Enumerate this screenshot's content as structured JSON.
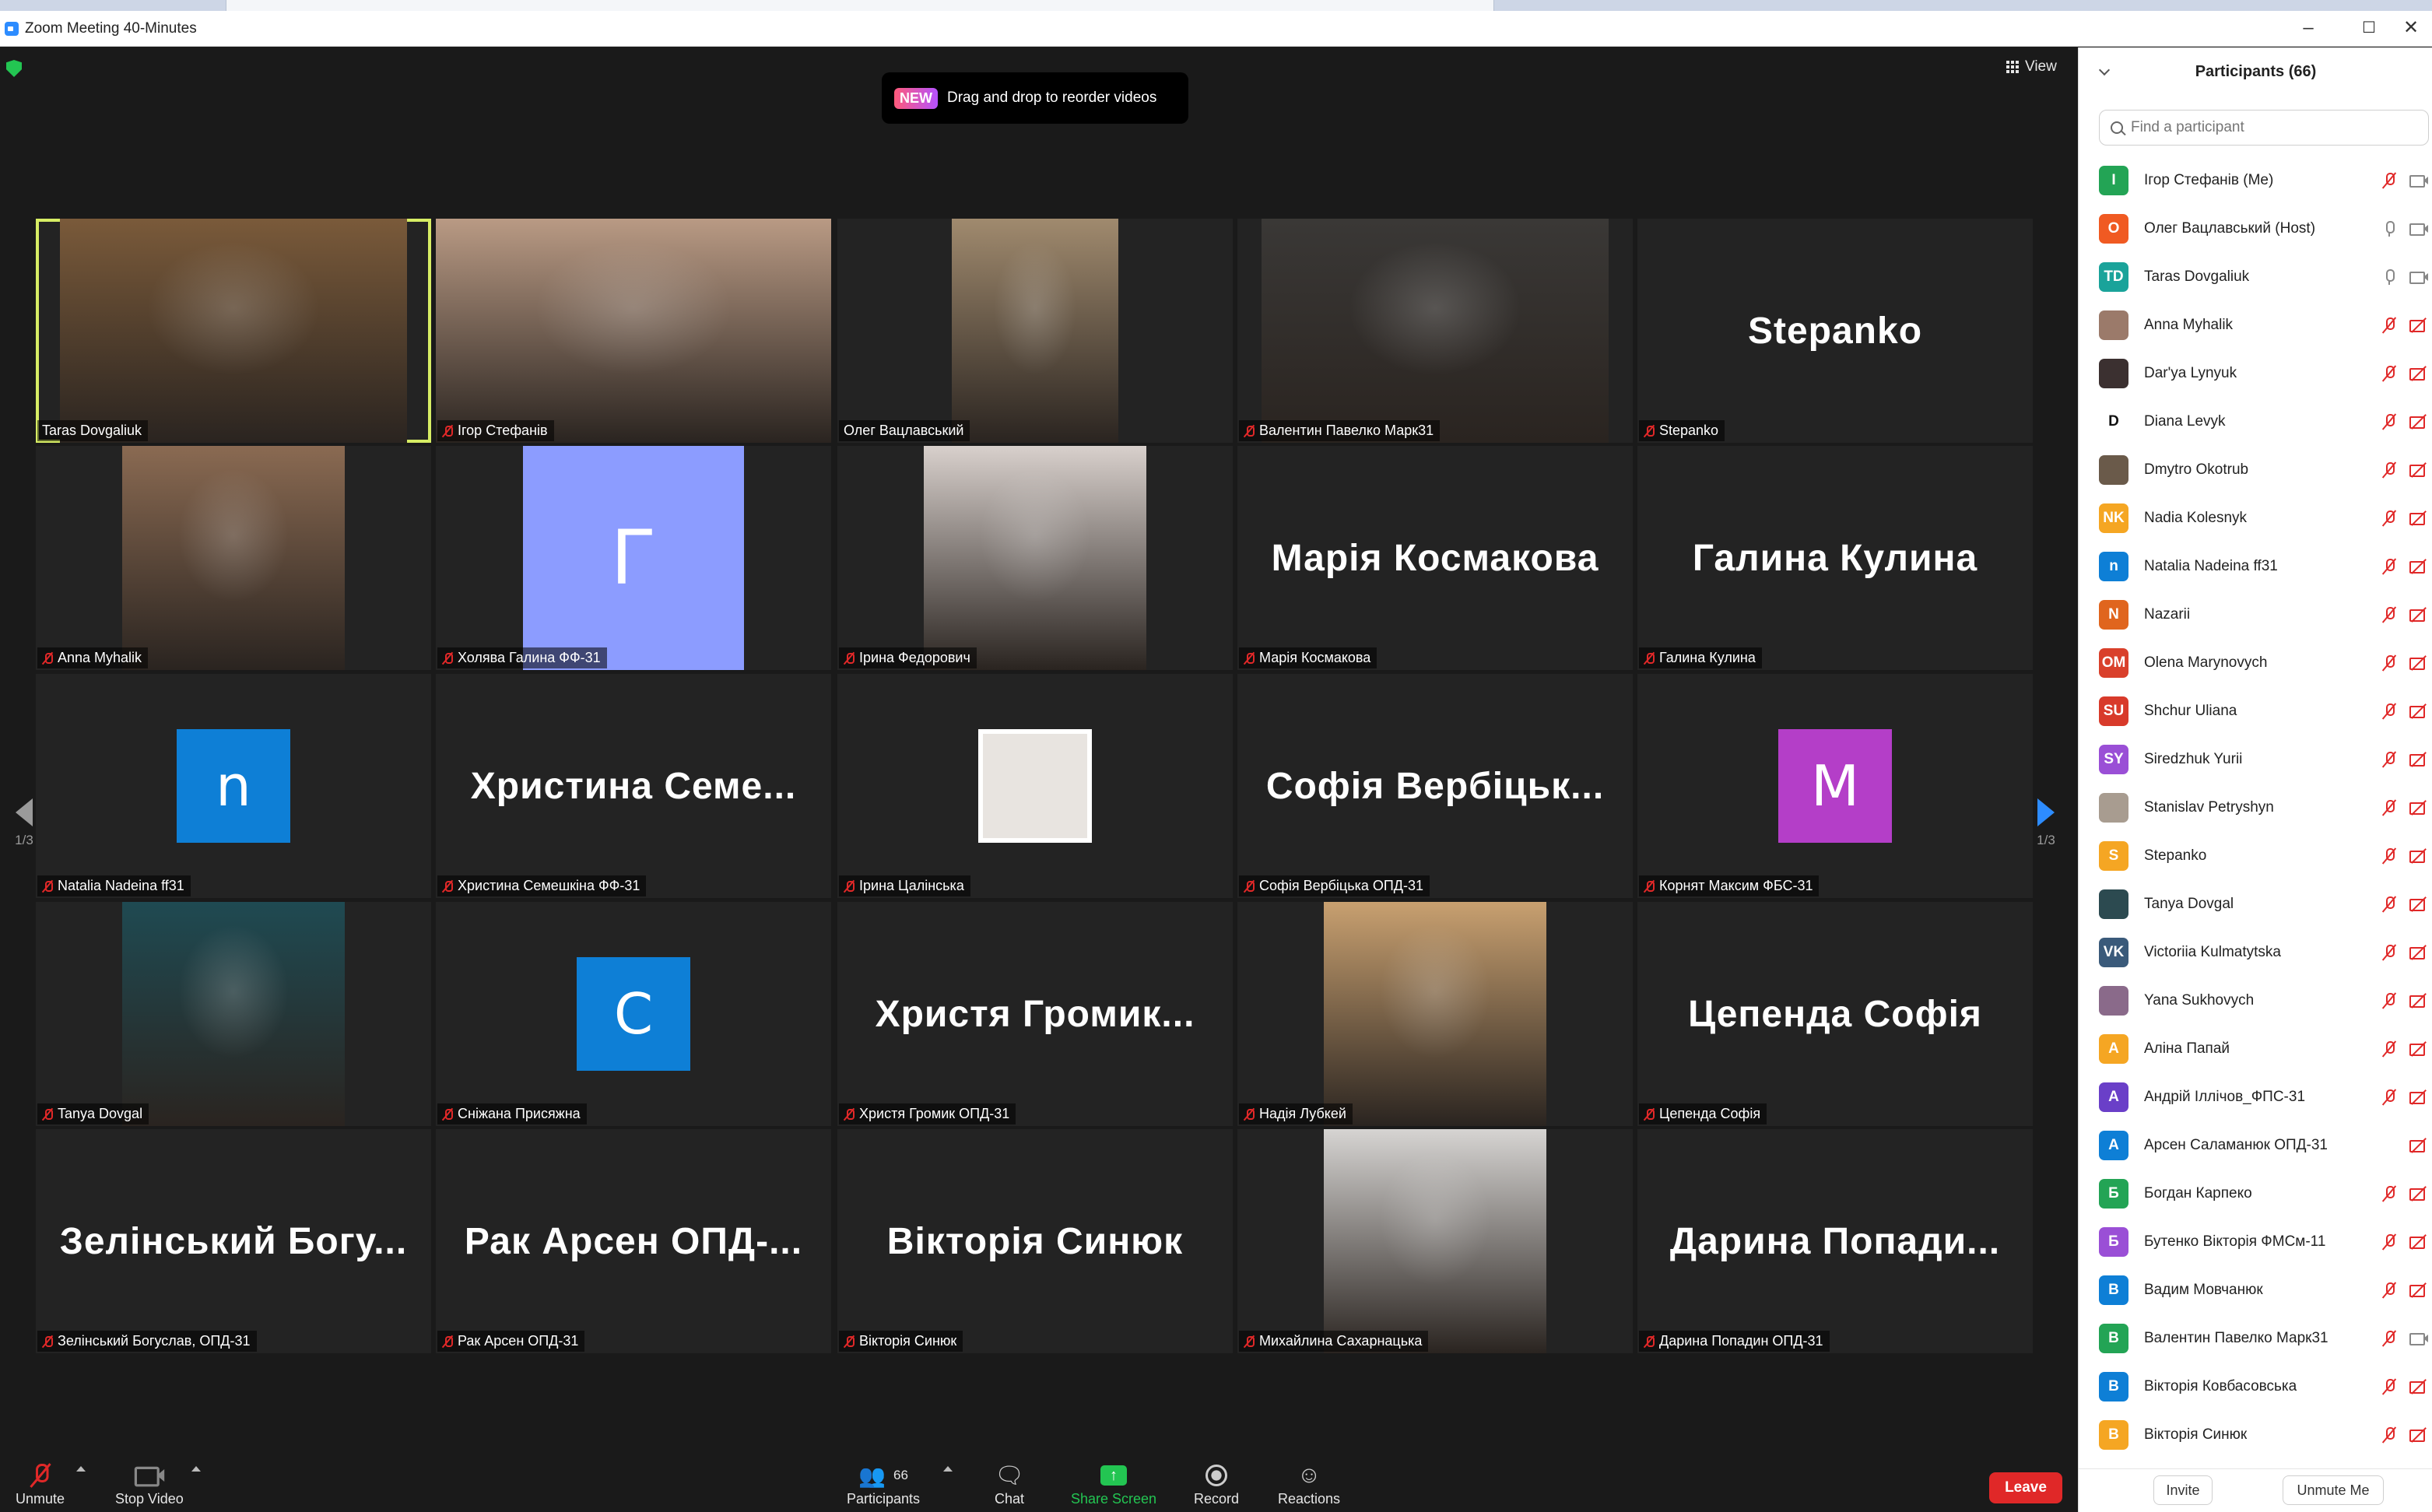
{
  "window": {
    "title": "Zoom Meeting 40-Minutes"
  },
  "toast": {
    "badge": "NEW",
    "message": "Drag and drop to reorder videos"
  },
  "view_label": "View",
  "pagination": {
    "left": "1/3",
    "right": "1/3"
  },
  "tiles": [
    {
      "label": "Taras Dovgaliuk",
      "muted": false,
      "active": true,
      "kind": "photo",
      "photo_color": "#7a5a3a"
    },
    {
      "label": "Ігор Стефанів",
      "muted": true,
      "kind": "photo",
      "photo_color": "#b99a84"
    },
    {
      "label": "Олег Вацлавський",
      "muted": false,
      "kind": "photo",
      "photo_color": "#a08a6e"
    },
    {
      "label": "Валентин Павелко Марк31",
      "muted": true,
      "kind": "photo",
      "photo_color": "#3a3836"
    },
    {
      "label": "Stepanko",
      "muted": true,
      "kind": "name",
      "big": "Stepanko"
    },
    {
      "label": "Anna Myhalik",
      "muted": true,
      "kind": "photo",
      "photo_color": "#8a6a52"
    },
    {
      "label": "Холява Галина ФФ-31",
      "muted": true,
      "kind": "letter",
      "letter": "Г",
      "letter_color": "#8c9cff"
    },
    {
      "label": "Ірина Федорович",
      "muted": true,
      "kind": "photo",
      "photo_color": "#d8d0cc"
    },
    {
      "label": "Марія Космакова",
      "muted": true,
      "kind": "name",
      "big": "Марія Космакова"
    },
    {
      "label": "Галина Кулина",
      "muted": true,
      "kind": "name",
      "big": "Галина Кулина"
    },
    {
      "label": "Natalia Nadeina ff31",
      "muted": true,
      "kind": "letter",
      "letter": "n",
      "letter_color": "#0e7fd6"
    },
    {
      "label": "Христина Семешкіна ФФ-31",
      "muted": true,
      "kind": "name",
      "big": "Христина Семе..."
    },
    {
      "label": "Ірина Цалінська",
      "muted": true,
      "kind": "smallphoto",
      "photo_color": "#e8e4e0"
    },
    {
      "label": "Софія Вербіцька ОПД-31",
      "muted": true,
      "kind": "name",
      "big": "Софія Вербіцьк..."
    },
    {
      "label": "Корнят Максим ФБС-31",
      "muted": true,
      "kind": "letter",
      "letter": "M",
      "letter_color": "#b43ec8"
    },
    {
      "label": "Tanya Dovgal",
      "muted": true,
      "kind": "photo",
      "photo_color": "#1f4a52"
    },
    {
      "label": "Сніжана Присяжна",
      "muted": true,
      "kind": "letter",
      "letter": "C",
      "letter_color": "#0e7fd6"
    },
    {
      "label": "Христя Громик ОПД-31",
      "muted": true,
      "kind": "name",
      "big": "Христя Громик..."
    },
    {
      "label": "Надія Лубкей",
      "muted": true,
      "kind": "photo",
      "photo_color": "#c8a070"
    },
    {
      "label": "Цепенда Софія",
      "muted": true,
      "kind": "name",
      "big": "Цепенда Софія"
    },
    {
      "label": "Зелінський Богуслав, ОПД-31",
      "muted": true,
      "kind": "name",
      "big": "Зелінський Богу..."
    },
    {
      "label": "Рак Арсен ОПД-31",
      "muted": true,
      "kind": "name",
      "big": "Рак Арсен ОПД-..."
    },
    {
      "label": "Вікторія Синюк",
      "muted": true,
      "kind": "name",
      "big": "Вікторія Синюк"
    },
    {
      "label": "Михайлина Сахарнацька",
      "muted": true,
      "kind": "photo",
      "photo_color": "#d6d4d2"
    },
    {
      "label": "Дарина Попадин ОПД-31",
      "muted": true,
      "kind": "name",
      "big": "Дарина Попади..."
    }
  ],
  "toolbar": {
    "unmute": "Unmute",
    "stop_video": "Stop Video",
    "participants": "Participants",
    "participants_count": "66",
    "chat": "Chat",
    "share_screen": "Share Screen",
    "record": "Record",
    "reactions": "Reactions",
    "leave": "Leave"
  },
  "panel": {
    "title": "Participants (66)",
    "search_placeholder": "Find a participant",
    "invite": "Invite",
    "unmute_me": "Unmute Me",
    "participants": [
      {
        "initials": "I",
        "color": "#23a455",
        "name": "Ігор Стефанів (Me)",
        "mic": "muted",
        "cam": "on"
      },
      {
        "initials": "O",
        "color": "#f05a22",
        "name": "Олег Вацлавський (Host)",
        "mic": "on",
        "cam": "on"
      },
      {
        "initials": "TD",
        "color": "#1aa39a",
        "name": "Taras Dovgaliuk",
        "mic": "on",
        "cam": "on"
      },
      {
        "initials": "",
        "color": "#9b7a6a",
        "name": "Anna Myhalik",
        "mic": "muted",
        "cam": "off"
      },
      {
        "initials": "",
        "color": "#3b3030",
        "name": "Dar'ya Lynyuk",
        "mic": "muted",
        "cam": "off"
      },
      {
        "initials": "D",
        "color": "#ffffff",
        "name": "Diana Levyk",
        "mic": "muted",
        "cam": "off"
      },
      {
        "initials": "",
        "color": "#6a5a4a",
        "name": "Dmytro Okotrub",
        "mic": "muted",
        "cam": "off"
      },
      {
        "initials": "NK",
        "color": "#f5a623",
        "name": "Nadia Kolesnyk",
        "mic": "muted",
        "cam": "off"
      },
      {
        "initials": "n",
        "color": "#0e7fd6",
        "name": "Natalia Nadeina ff31",
        "mic": "muted",
        "cam": "off"
      },
      {
        "initials": "N",
        "color": "#e0651e",
        "name": "Nazarii",
        "mic": "muted",
        "cam": "off"
      },
      {
        "initials": "OM",
        "color": "#d9402b",
        "name": "Olena Marynovych",
        "mic": "muted",
        "cam": "off"
      },
      {
        "initials": "SU",
        "color": "#d83a2a",
        "name": "Shchur Uliana",
        "mic": "muted",
        "cam": "off"
      },
      {
        "initials": "SY",
        "color": "#9a4fd6",
        "name": "Siredzhuk Yurii",
        "mic": "muted",
        "cam": "off"
      },
      {
        "initials": "",
        "color": "#a89c90",
        "name": "Stanislav Petryshyn",
        "mic": "muted",
        "cam": "off"
      },
      {
        "initials": "S",
        "color": "#f5a623",
        "name": "Stepanko",
        "mic": "muted",
        "cam": "off"
      },
      {
        "initials": "",
        "color": "#2c4a50",
        "name": "Tanya Dovgal",
        "mic": "muted",
        "cam": "off"
      },
      {
        "initials": "VK",
        "color": "#3a5a7a",
        "name": "Victoriia Kulmatytska",
        "mic": "muted",
        "cam": "off"
      },
      {
        "initials": "",
        "color": "#8a6a8a",
        "name": "Yana Sukhovych",
        "mic": "muted",
        "cam": "off"
      },
      {
        "initials": "A",
        "color": "#f5a623",
        "name": "Аліна Папай",
        "mic": "muted",
        "cam": "off"
      },
      {
        "initials": "A",
        "color": "#6a3fc8",
        "name": "Андрій Іллічов_ФПС-31",
        "mic": "muted",
        "cam": "off"
      },
      {
        "initials": "A",
        "color": "#0e7fd6",
        "name": "Арсен Саламанюк ОПД-31",
        "mic": "none",
        "cam": "off"
      },
      {
        "initials": "Б",
        "color": "#23a455",
        "name": "Богдан Карпеко",
        "mic": "muted",
        "cam": "off"
      },
      {
        "initials": "Б",
        "color": "#9a4fd6",
        "name": "Бутенко Вікторія ФМСм-11",
        "mic": "muted",
        "cam": "off"
      },
      {
        "initials": "B",
        "color": "#0e7fd6",
        "name": "Вадим Мовчанюк",
        "mic": "muted",
        "cam": "off"
      },
      {
        "initials": "B",
        "color": "#23a455",
        "name": "Валентин Павелко Марк31",
        "mic": "muted",
        "cam": "on"
      },
      {
        "initials": "B",
        "color": "#0e7fd6",
        "name": "Вікторія Ковбасовська",
        "mic": "muted",
        "cam": "off"
      },
      {
        "initials": "B",
        "color": "#f5a623",
        "name": "Вікторія Синюк",
        "mic": "muted",
        "cam": "off"
      }
    ]
  }
}
